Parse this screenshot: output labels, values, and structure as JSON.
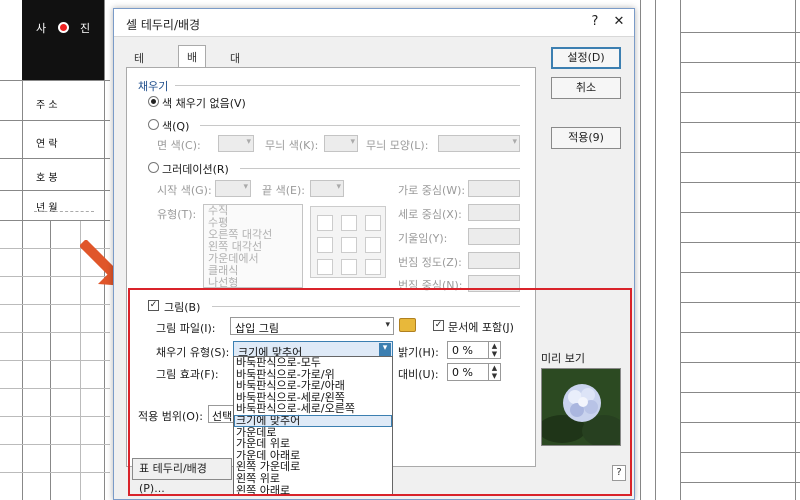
{
  "background": {
    "photo_label_left": "사",
    "photo_label_right": "진",
    "labels": [
      "주 소",
      "연 락",
      "호 봉",
      "년 월"
    ]
  },
  "dialog": {
    "title": "셀 테두리/배경",
    "help_glyph": "?",
    "close_glyph": "✕",
    "tabs": [
      "테두리",
      "배경",
      "대각선"
    ],
    "buttons": {
      "ok": "설정(D)",
      "cancel": "취소",
      "apply": "적용(9)"
    },
    "fill_section": "채우기",
    "no_fill": "색 채우기 없음(V)",
    "color": "색(Q)",
    "face_color": "면 색(C):",
    "pattern_color": "무늬 색(K):",
    "pattern_shape": "무늬 모양(L):",
    "gradient": "그러데이션(R)",
    "start_color": "시작 색(G):",
    "end_color": "끝 색(E):",
    "h_center": "가로 중심(W):",
    "v_center": "세로 중심(X):",
    "slope": "기울임(Y):",
    "change_degree": "번짐 정도(Z):",
    "change_center": "번짐 중심(N):",
    "type_label": "유형(T):",
    "gradient_types": [
      "수직",
      "수평",
      "오른쪽 대각선",
      "왼쪽 대각선",
      "가운데에서",
      "클래식",
      "나선형"
    ],
    "picture_check": "그림(B)",
    "picture_file": "그림 파일(I):",
    "picture_file_value": "삽입 그림",
    "embed_check": "문서에 포함(J)",
    "fill_type": "채우기 유형(S):",
    "fill_type_value": "크기에 맞추어",
    "picture_effect": "그림 효과(F):",
    "brightness": "밝기(H):",
    "brightness_value": "0 %",
    "contrast": "대비(U):",
    "contrast_value": "0 %",
    "apply_range": "적용 범위(O):",
    "apply_range_value": "선택",
    "preview_label": "미리 보기",
    "footer_button": "표 테두리/배경(P)...",
    "help_button": "?",
    "fill_type_options": [
      "바둑판식으로-모두",
      "바둑판식으로-가로/위",
      "바둑판식으로-가로/아래",
      "바둑판식으로-세로/왼쪽",
      "바둑판식으로-세로/오른쪽",
      "크기에 맞추어",
      "가운데로",
      "가운데 위로",
      "가운데 아래로",
      "왼쪽 가운데로",
      "왼쪽 위로",
      "왼쪽 아래로"
    ],
    "fill_type_selected_index": 5
  },
  "colors": {
    "accent": "#3c7fb1",
    "highlight": "#d9232a",
    "arrow": "#e0562a"
  }
}
